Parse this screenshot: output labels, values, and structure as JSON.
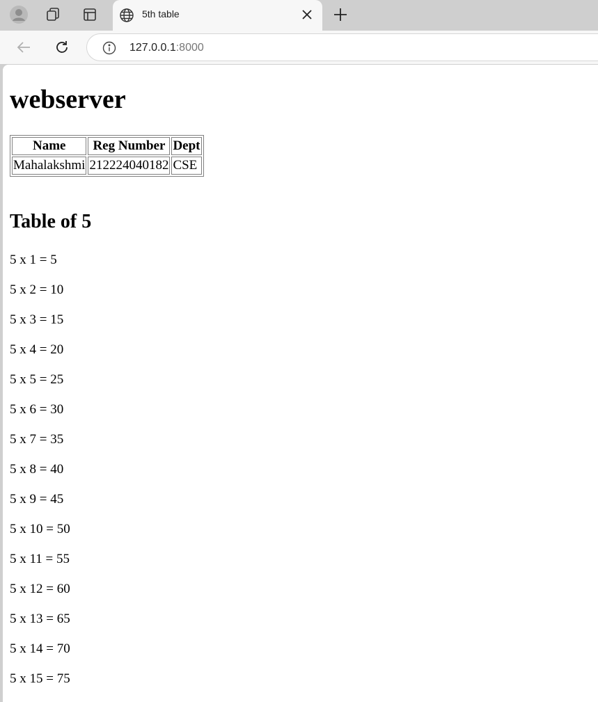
{
  "browser": {
    "tab_title": "5th table",
    "url_host": "127.0.0.1",
    "url_port": ":8000"
  },
  "page": {
    "heading": "webserver",
    "table": {
      "headers": [
        "Name",
        "Reg Number",
        "Dept"
      ],
      "row": [
        "Mahalakshmi",
        "212224040182",
        "CSE"
      ]
    },
    "section_title": "Table of 5",
    "lines": [
      "5 x 1 = 5",
      "5 x 2 = 10",
      "5 x 3 = 15",
      "5 x 4 = 20",
      "5 x 5 = 25",
      "5 x 6 = 30",
      "5 x 7 = 35",
      "5 x 8 = 40",
      "5 x 9 = 45",
      "5 x 10 = 50",
      "5 x 11 = 55",
      "5 x 12 = 60",
      "5 x 13 = 65",
      "5 x 14 = 70",
      "5 x 15 = 75"
    ]
  },
  "icons": {
    "profile": "profile-icon",
    "workspaces": "workspaces-icon",
    "tab_actions": "tab-actions-icon",
    "globe": "globe-icon",
    "close": "close-icon",
    "new_tab": "plus-icon",
    "back": "back-arrow-icon",
    "reload": "reload-icon",
    "info": "info-icon"
  }
}
